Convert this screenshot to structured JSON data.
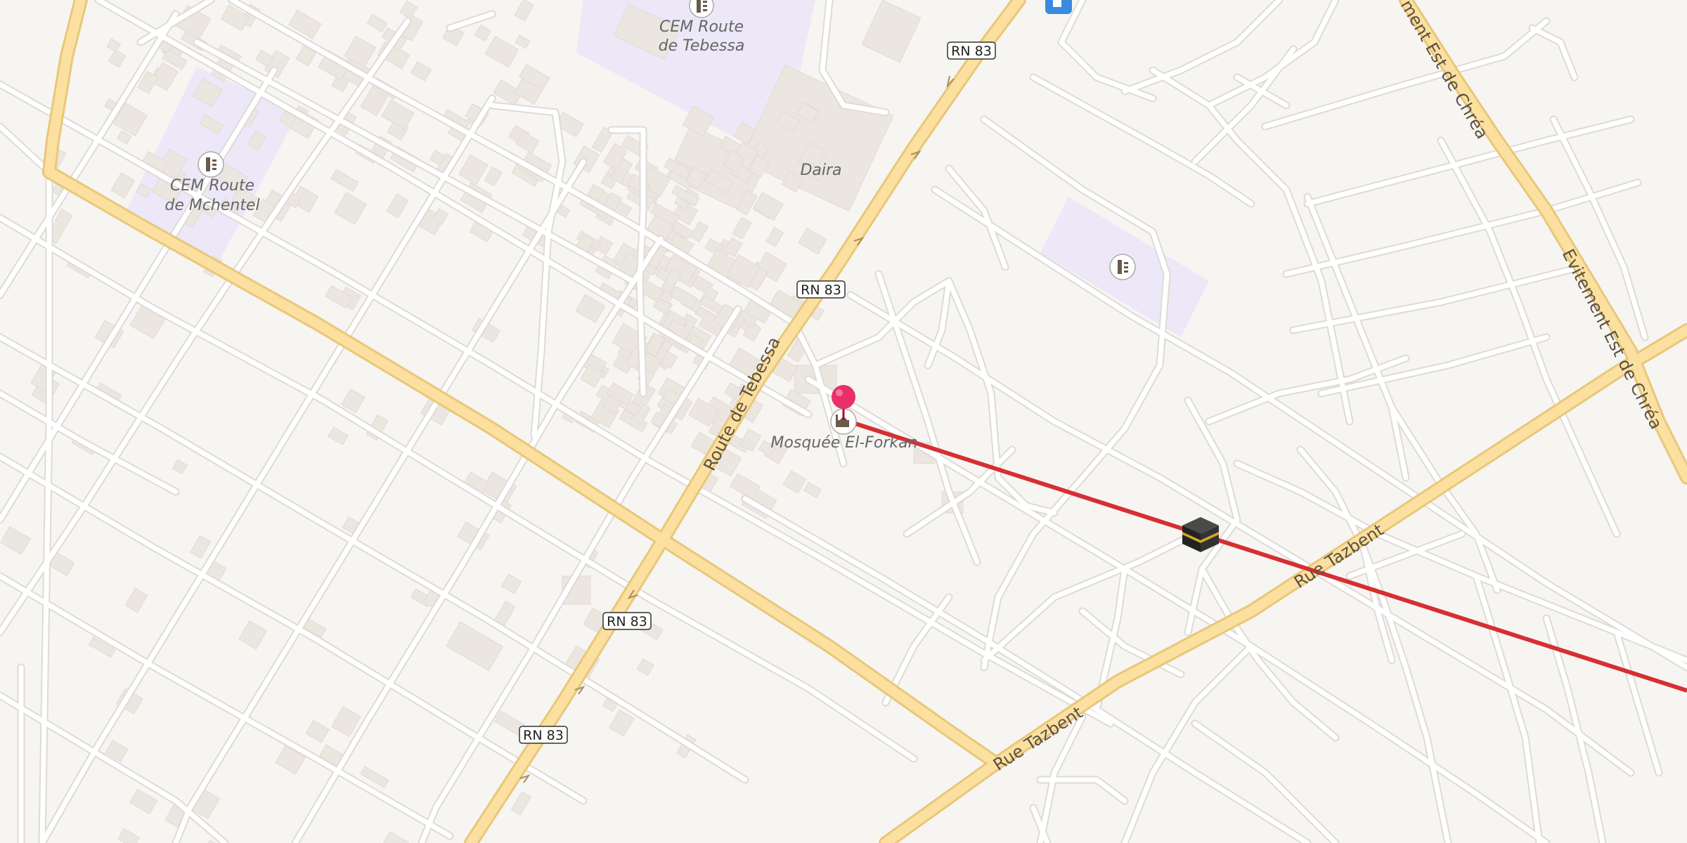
{
  "map": {
    "colors": {
      "background": "#f7f5f2",
      "road_minor": "#ffffff",
      "road_minor_casing": "#dedbd6",
      "road_major": "#fbe0a0",
      "road_major_casing": "#e9c77a",
      "building": "#ebe6e0",
      "school_area": "#ece8f8",
      "qibla_line": "#d62f33",
      "pin": "#e8306a"
    },
    "places": {
      "cem_tebessa": {
        "line1": "CEM Route",
        "line2": "de Tebessa",
        "icon": "school-icon"
      },
      "cem_mchentel": {
        "line1": "CEM Route",
        "line2": "de Mchentel",
        "icon": "school-icon"
      },
      "daira": {
        "name": "Daira"
      },
      "mosque": {
        "name": "Mosquée El-Forkan",
        "icon": "mosque-icon"
      },
      "school_east": {
        "icon": "school-icon"
      }
    },
    "road_shields": {
      "s1": "RN 83",
      "s2": "RN 83",
      "s3": "RN 83",
      "s4": "RN 83"
    },
    "road_labels": {
      "route_de_tebessa": "Route de Tebessa",
      "rue_tazbent_1": "Rue Tazbent",
      "rue_tazbent_2": "Rue Tazbent",
      "evitement_1": "Evitement Est de Chréa",
      "evitement_2": "ment Est de Chréa"
    },
    "markers": {
      "pin": "location-pin-icon",
      "kaaba": "kaaba-icon",
      "fuel": "fuel-station-icon"
    },
    "qibla_line": {
      "label": "qibla-direction-line"
    }
  }
}
